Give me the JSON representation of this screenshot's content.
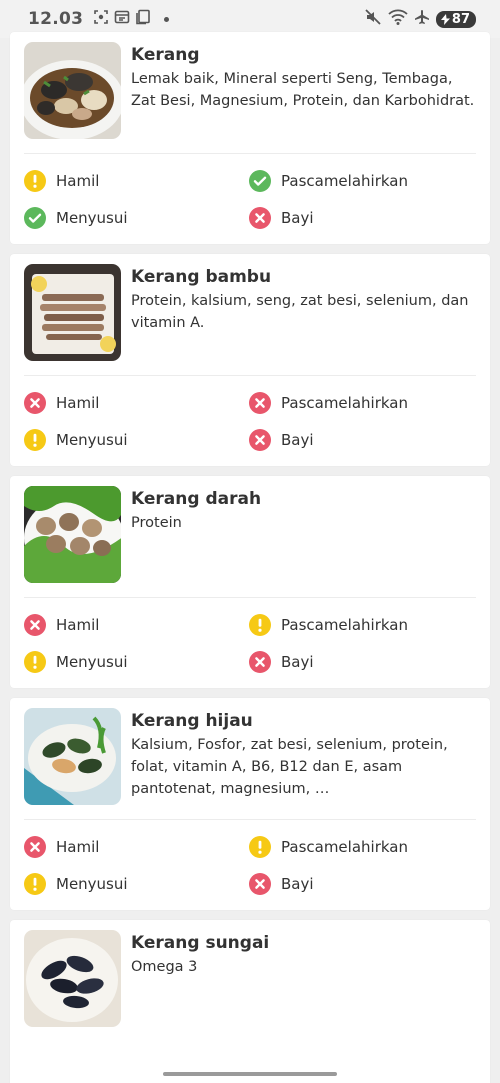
{
  "status_bar": {
    "time": "12.03",
    "battery": "87"
  },
  "labels": {
    "hamil": "Hamil",
    "pasca": "Pascamelahirkan",
    "menyusui": "Menyusui",
    "bayi": "Bayi"
  },
  "colors": {
    "safe": "#5cb85c",
    "caution": "#f6c915",
    "unsafe": "#e8566b"
  },
  "foods": [
    {
      "name": "Kerang",
      "nutrients": "Lemak baik, Mineral seperti Seng, Tembaga, Zat Besi, Magnesium, Protein, dan Karbohidrat.",
      "image": "clams-in-bowl",
      "hamil": "caution",
      "pasca": "safe",
      "menyusui": "safe",
      "bayi": "unsafe"
    },
    {
      "name": "Kerang bambu",
      "nutrients": "Protein, kalsium, seng, zat besi, selenium, dan vitamin A.",
      "image": "razor-clams-plate",
      "hamil": "unsafe",
      "pasca": "unsafe",
      "menyusui": "caution",
      "bayi": "unsafe"
    },
    {
      "name": "Kerang darah",
      "nutrients": "Protein",
      "image": "blood-cockles",
      "hamil": "unsafe",
      "pasca": "caution",
      "menyusui": "caution",
      "bayi": "unsafe"
    },
    {
      "name": "Kerang hijau",
      "nutrients": "Kalsium, Fosfor, zat besi, selenium, protein, folat, vitamin A, B6, B12 dan E, asam pantotenat, magnesium, …",
      "image": "green-mussels",
      "hamil": "unsafe",
      "pasca": "caution",
      "menyusui": "caution",
      "bayi": "unsafe"
    },
    {
      "name": "Kerang sungai",
      "nutrients": "Omega 3",
      "image": "river-mussels",
      "hamil": null,
      "pasca": null,
      "menyusui": null,
      "bayi": null
    }
  ]
}
